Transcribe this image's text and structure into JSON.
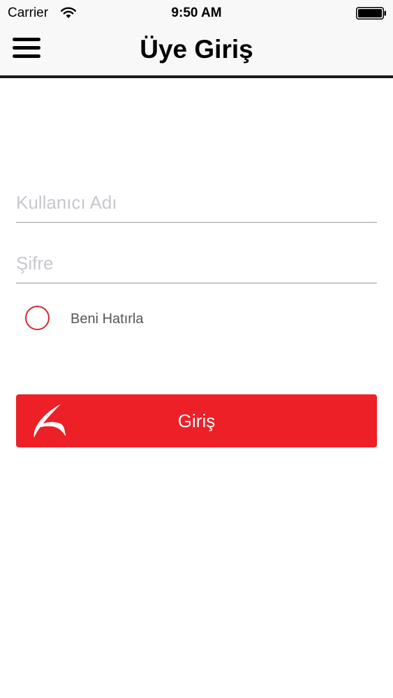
{
  "status_bar": {
    "carrier": "Carrier",
    "time": "9:50 AM",
    "wifi_icon": "wifi-icon",
    "battery_icon": "battery-icon"
  },
  "nav": {
    "title": "Üye Giriş",
    "menu_icon": "hamburger-menu-icon"
  },
  "form": {
    "username": {
      "value": "",
      "placeholder": "Kullanıcı Adı"
    },
    "password": {
      "value": "",
      "placeholder": "Şifre"
    },
    "remember_me": {
      "label": "Beni Hatırla",
      "checked": false
    },
    "login_button": {
      "label": "Giriş",
      "logo_icon": "brand-logo-icon"
    }
  },
  "colors": {
    "accent": "#ed1f27",
    "radio_border": "#d42a2f",
    "nav_background": "#f8f8f8",
    "placeholder": "#c7c7cd"
  }
}
